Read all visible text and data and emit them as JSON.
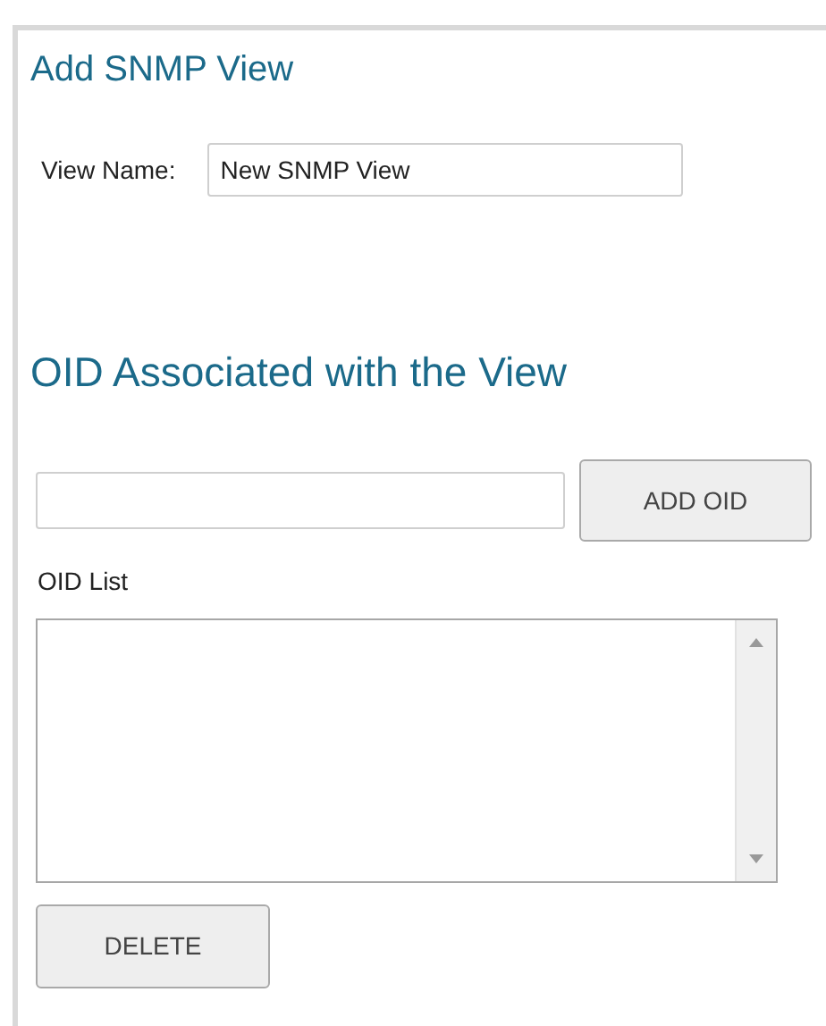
{
  "title": "Add SNMP View",
  "view_name": {
    "label": "View Name:",
    "value": "New SNMP View"
  },
  "oid_section": {
    "heading": "OID Associated with the View",
    "add_button": "ADD OID",
    "list_label": "OID List",
    "delete_button": "DELETE"
  }
}
